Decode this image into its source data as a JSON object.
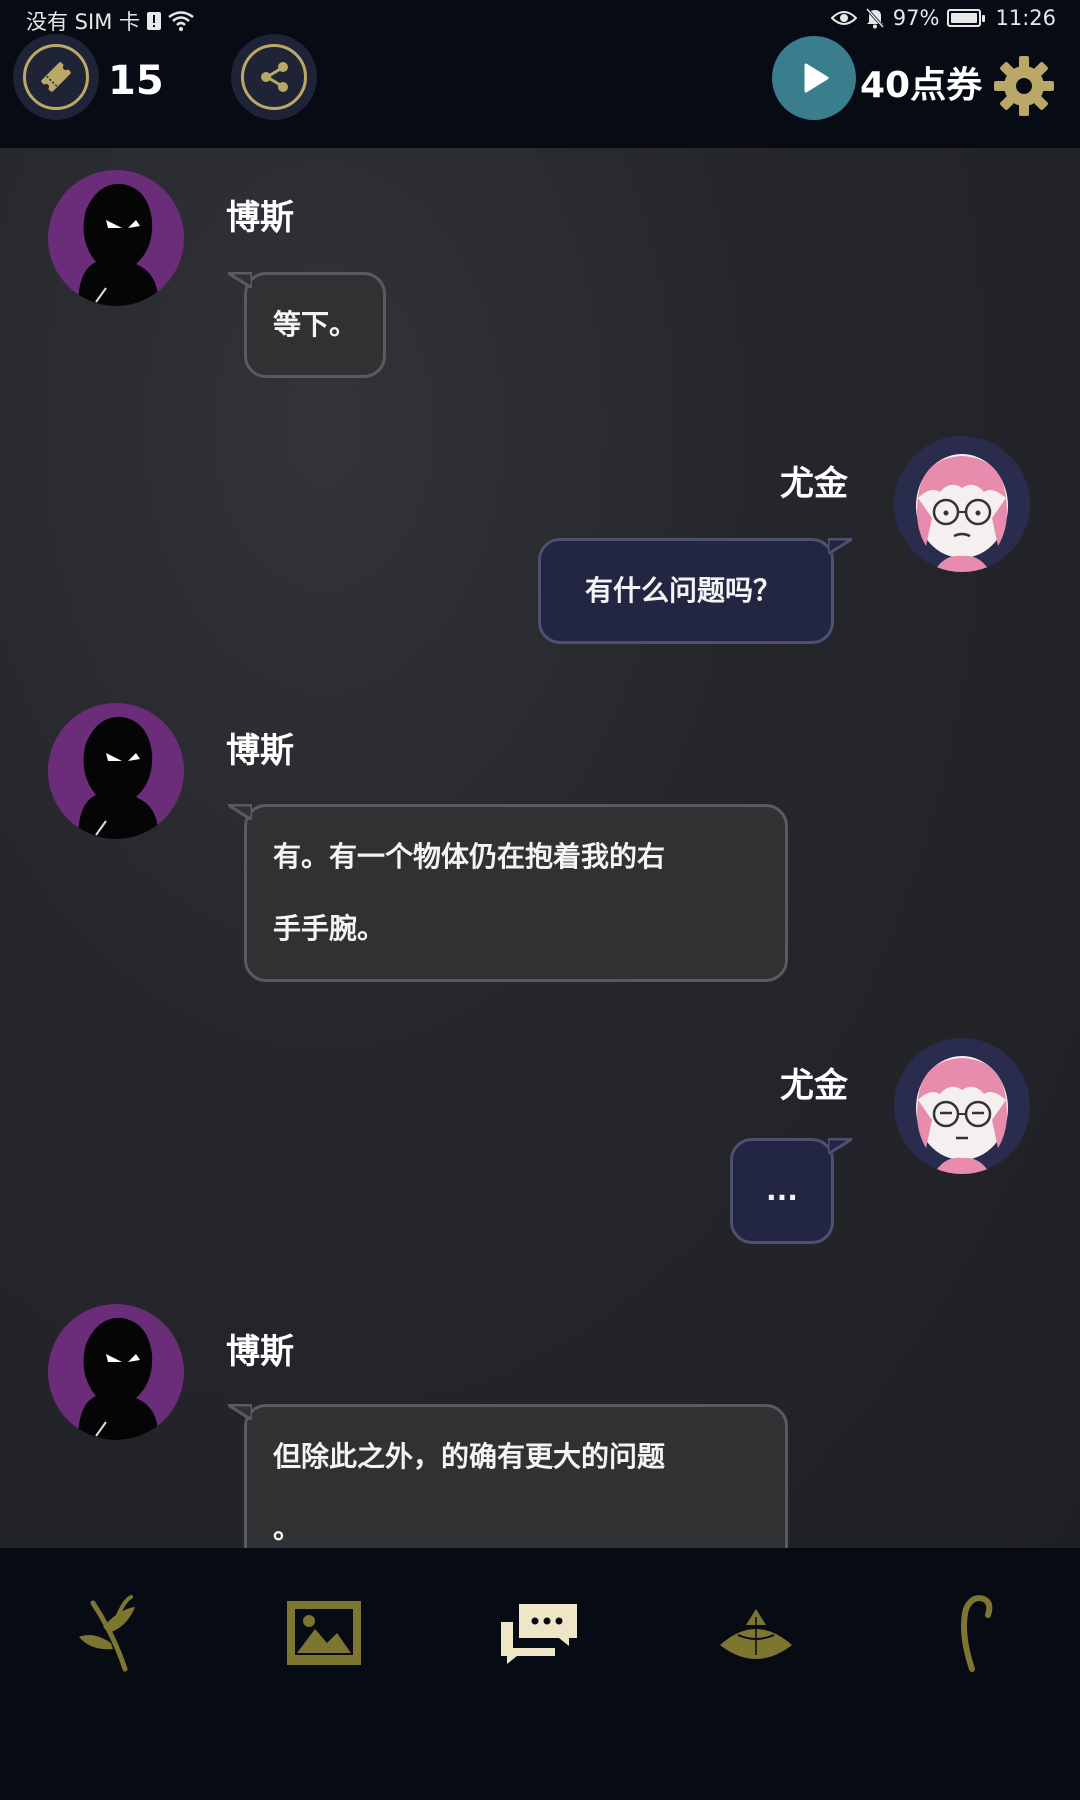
{
  "status_bar": {
    "carrier": "没有 SIM 卡",
    "battery": "97%",
    "time": "11:26"
  },
  "top_bar": {
    "ticket_count": "15",
    "points_label": "40点券"
  },
  "messages": [
    {
      "speaker": "博斯",
      "side": "left",
      "avatar": "boss-avatar",
      "text_lines": [
        "等下。"
      ]
    },
    {
      "speaker": "尤金",
      "side": "right",
      "avatar": "eugene-avatar",
      "text_lines": [
        "有什么问题吗？"
      ]
    },
    {
      "speaker": "博斯",
      "side": "left",
      "avatar": "boss-avatar",
      "text_lines": [
        "有。有一个物体仍在抱着我的右",
        "手手腕。"
      ]
    },
    {
      "speaker": "尤金",
      "side": "right",
      "avatar": "eugene-avatar",
      "text_lines": [
        "..."
      ]
    },
    {
      "speaker": "博斯",
      "side": "left",
      "avatar": "boss-avatar",
      "text_lines": [
        "但除此之外，的确有更大的问题",
        "。"
      ]
    }
  ],
  "bottom_nav": {
    "items": [
      {
        "icon": "sprout-icon"
      },
      {
        "icon": "gallery-icon"
      },
      {
        "icon": "chat-icon",
        "active": true
      },
      {
        "icon": "hat-icon"
      },
      {
        "icon": "cane-icon"
      }
    ]
  },
  "colors": {
    "background": "#070b14",
    "accent_gold": "#b9a868",
    "nav_icon": "#7d7630",
    "nav_icon_active": "#efe6c8",
    "play_button": "#3a7d8c",
    "left_bubble": "#303133",
    "right_bubble": "#232642"
  }
}
